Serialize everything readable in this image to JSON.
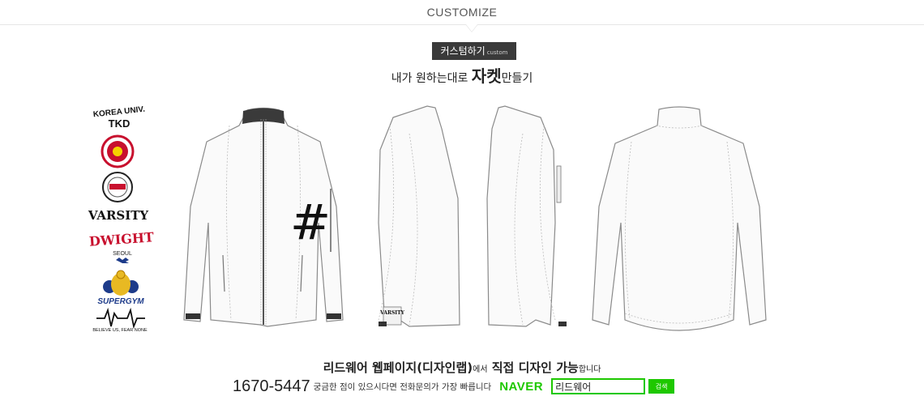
{
  "top_tab": {
    "title": "CUSTOMIZE"
  },
  "badge": {
    "main": "커스텀하기",
    "sub": "custom"
  },
  "headline": {
    "pre": "내가 원하는대로 ",
    "emphasis": "자켓",
    "post": "만들기"
  },
  "logos": {
    "korea_univ": {
      "line1": "KOREA UNIV.",
      "line2": "TKD"
    },
    "varsity": "VARSITY",
    "dwight": {
      "name": "DWIGHT",
      "sub": "SEOUL"
    },
    "supergym": "SUPERGYM",
    "believe": "BELIEVE US, FEAR NONE"
  },
  "jacket": {
    "chest_mark": "#",
    "sleeve_print": "VARSITY"
  },
  "info": {
    "line1_main": "리드웨어 웹페이지(디자인랩)",
    "line1_small": "에서",
    "line1_main2": " 직접 디자인 가능",
    "line1_small2": "합니다",
    "phone": "1670-5447",
    "phone_note": "궁금한 점이 있으시다면 전화문의가 가장 빠릅니다",
    "naver": "NAVER",
    "search_value": "리드웨어",
    "search_button": "검색"
  },
  "colors": {
    "naver_green": "#1ec800",
    "badge_bg": "#3a3a3a",
    "jacket_stroke": "#8a8a8a"
  }
}
